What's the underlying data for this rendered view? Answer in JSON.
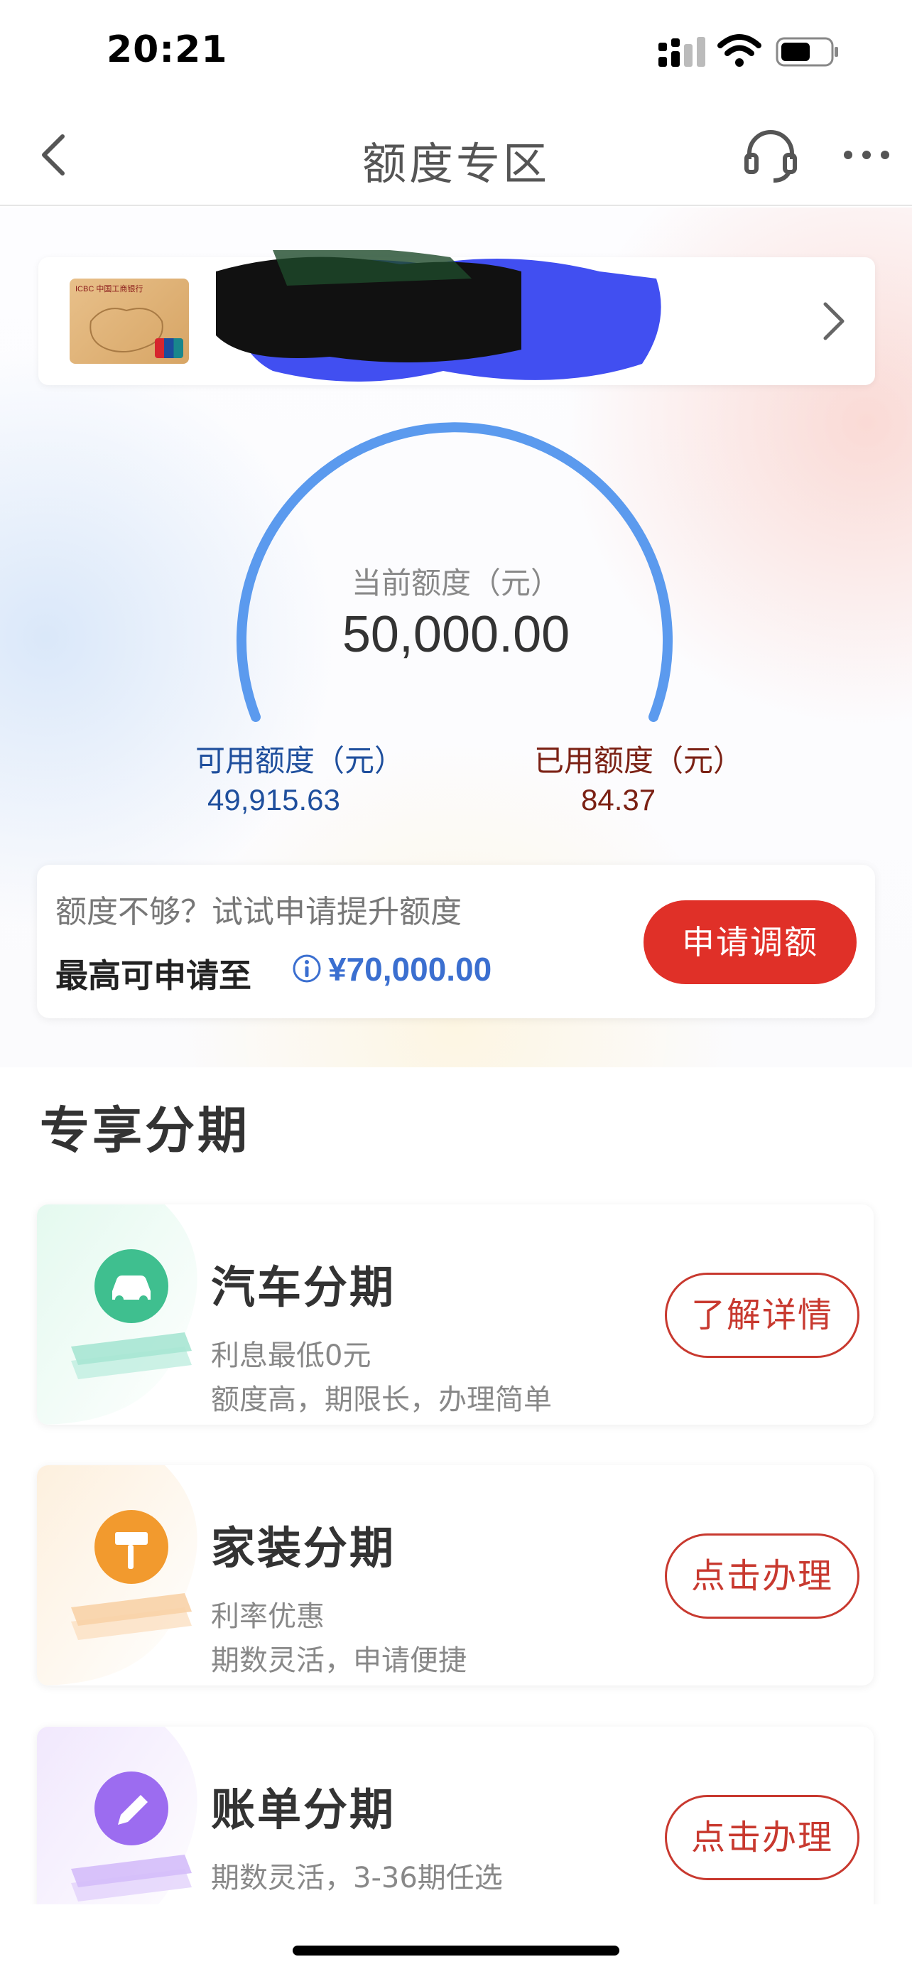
{
  "status_bar": {
    "time": "20:21"
  },
  "nav": {
    "title": "额度专区"
  },
  "card": {
    "bank_brand": "ICBC 中国工商银行"
  },
  "gauge": {
    "label": "当前额度（元）",
    "value": "50,000.00",
    "used_fraction": 0.0017
  },
  "available": {
    "label": "可用额度（元）",
    "value": "49,915.63"
  },
  "used": {
    "label": "已用额度（元）",
    "value": "84.37"
  },
  "boost": {
    "hint": "额度不够？试试申请提升额度",
    "max_label": "最高可申请至",
    "max_amount": "¥70,000.00",
    "apply_label": "申请调额"
  },
  "section": {
    "title": "专享分期"
  },
  "promos": [
    {
      "title": "汽车分期",
      "line1": "利息最低0元",
      "line2": "额度高，期限长，办理简单",
      "button": "了解详情",
      "icon": "car-icon",
      "color": "#3fbf8f"
    },
    {
      "title": "家装分期",
      "line1": "利率优惠",
      "line2": "期数灵活，申请便捷",
      "button": "点击办理",
      "icon": "paint-roller-icon",
      "color": "#f29a2e"
    },
    {
      "title": "账单分期",
      "line1": "期数灵活，3-36期任选",
      "line2": "",
      "button": "点击办理",
      "icon": "pencil-icon",
      "color": "#9c6cf0"
    }
  ],
  "colors": {
    "accent_red": "#e03028",
    "gauge_blue": "#5b9aee",
    "link_blue": "#3b6fd0"
  }
}
